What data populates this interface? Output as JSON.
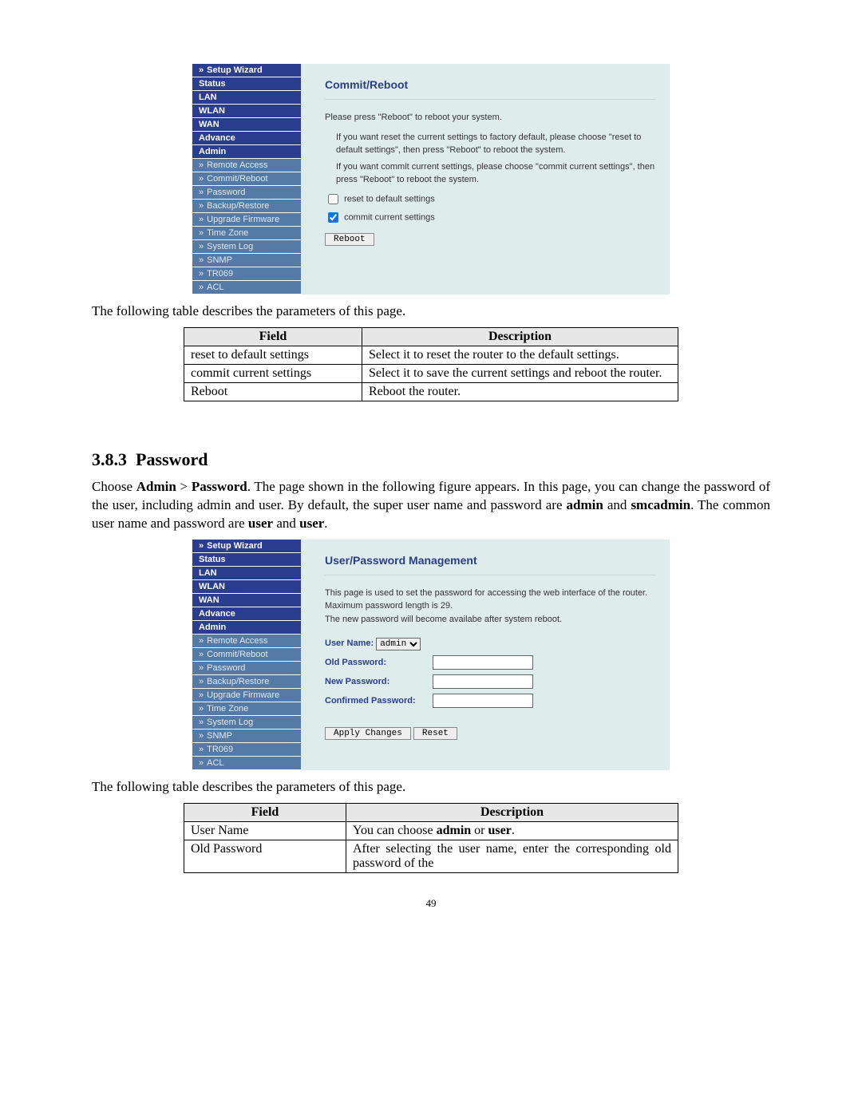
{
  "sidebar": {
    "setupWizard": "Setup Wizard",
    "status": "Status",
    "lan": "LAN",
    "wlan": "WLAN",
    "wan": "WAN",
    "advance": "Advance",
    "admin": "Admin",
    "sub": {
      "remoteAccess": "Remote Access",
      "commitReboot": "Commit/Reboot",
      "password": "Password",
      "backupRestore": "Backup/Restore",
      "upgradeFirmware": "Upgrade Firmware",
      "timeZone": "Time Zone",
      "systemLog": "System Log",
      "snmp": "SNMP",
      "tr069": "TR069",
      "acl": "ACL"
    }
  },
  "commitReboot": {
    "title": "Commit/Reboot",
    "line1": "Please press \"Reboot\" to reboot your system.",
    "line2": "If you want reset the current settings to factory default, please choose \"reset to default settings\", then press \"Reboot\" to reboot the system.",
    "line3": "If you want commit current settings, please choose \"commit current settings\", then press \"Reboot\" to reboot the system.",
    "cb1": "reset to default settings",
    "cb2": "commit current settings",
    "btn": "Reboot"
  },
  "intro1": "The following table describes the parameters of this page.",
  "table1": {
    "hField": "Field",
    "hDesc": "Description",
    "r1f": "reset to default settings",
    "r1d": "Select it to reset the router to the default settings.",
    "r2f": "commit current settings",
    "r2d": "Select it to save the current settings and reboot the router.",
    "r3f": "Reboot",
    "r3d": "Reboot the router."
  },
  "section": {
    "num": "3.8.3",
    "title": "Password"
  },
  "pwIntro": {
    "p1a": "Choose ",
    "p1b": "Admin",
    "p1c": " > ",
    "p1d": "Password",
    "p1e": ". The page shown in the following figure appears. In this page, you can change the password of the user, including admin and user. By default, the super user name and password are ",
    "p1f": "admin",
    "p1g": " and ",
    "p1h": "smcadmin",
    "p1i": ". The common user name and password are ",
    "p1j": "user",
    "p1k": " and ",
    "p1l": "user",
    "p1m": "."
  },
  "pwPane": {
    "title": "User/Password Management",
    "desc1": "This page is used to set the password for accessing the web interface of the router.",
    "desc2": "Maximum password length is 29.",
    "desc3": "The new password will become availabe after system reboot.",
    "userLbl": "User Name:",
    "userSel": "admin",
    "oldLbl": "Old Password:",
    "newLbl": "New Password:",
    "confLbl": "Confirmed Password:",
    "applyBtn": "Apply Changes",
    "resetBtn": "Reset"
  },
  "intro2": "The following table describes the parameters of this page.",
  "table2": {
    "hField": "Field",
    "hDesc": "Description",
    "r1f": "User Name",
    "r1d_a": "You can choose ",
    "r1d_b": "admin",
    "r1d_c": " or ",
    "r1d_d": "user",
    "r1d_e": ".",
    "r2f": "Old Password",
    "r2d": "After selecting the user name, enter the corresponding old password of the"
  },
  "pageNumber": "49"
}
